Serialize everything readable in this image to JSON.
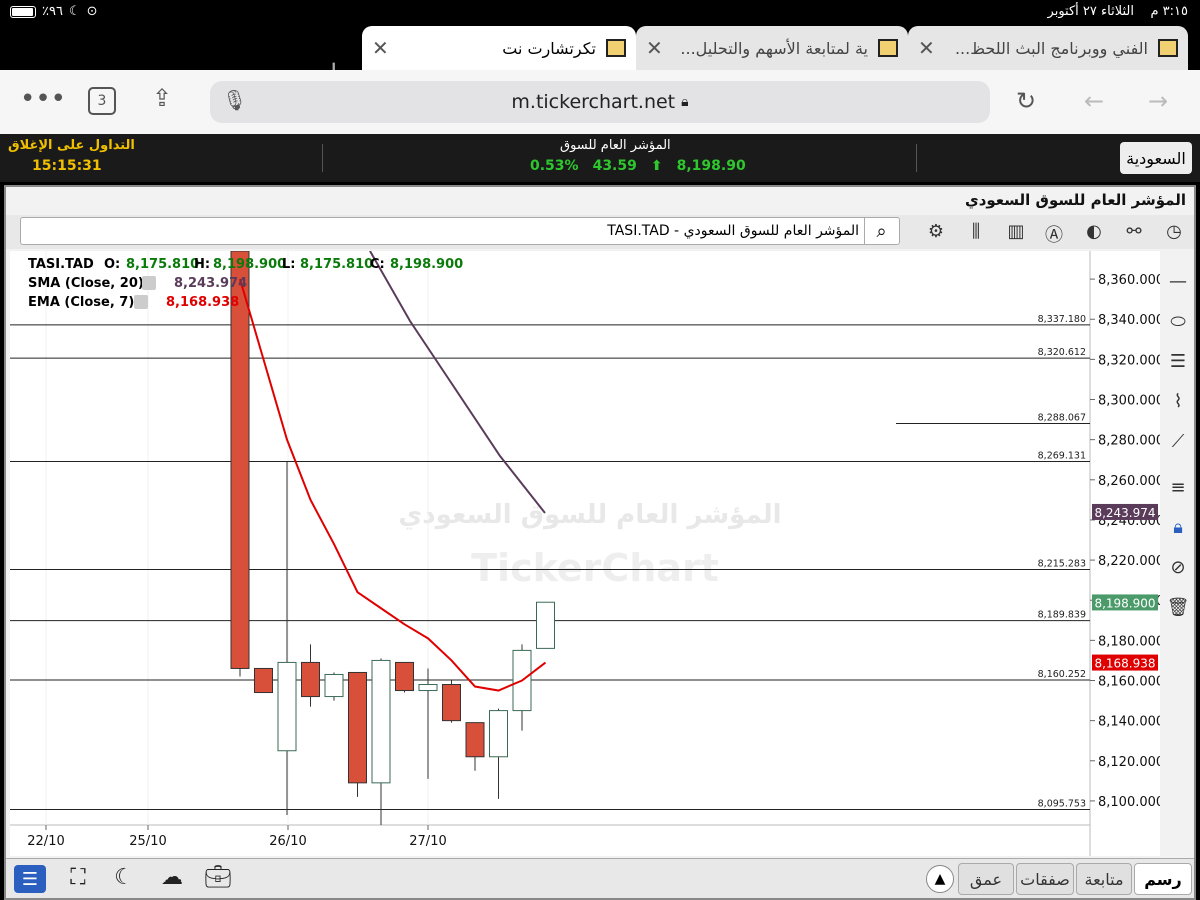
{
  "status": {
    "battery": "٪٩٦",
    "time": "٣:١٥ م",
    "date": "الثلاثاء ٢٧ أكتوبر"
  },
  "tabs": [
    {
      "label": "تكرتشارت نت",
      "active": true
    },
    {
      "label": "ية لمتابعة الأسهم والتحليل...",
      "active": false
    },
    {
      "label": "الفني ووبرنامج البث اللحظ...",
      "active": false
    }
  ],
  "browser": {
    "url": "m.tickerchart.net",
    "tab_count": "3"
  },
  "header": {
    "status_label": "التداول على الإغلاق",
    "clock": "15:15:31",
    "index_title": "المؤشر العام للسوق",
    "change_pct": "0.53%",
    "change": "43.59",
    "last": "8,198.90",
    "market": "السعودية"
  },
  "panel": {
    "title": "المؤشر العام للسوق السعودي",
    "symbol": "TASI.TAD - المؤشر العام للسوق السعودي"
  },
  "legend": {
    "ticker": "TASI.TAD",
    "o_label": "O:",
    "o": "8,175.810",
    "h_label": "H:",
    "h": "8,198.900",
    "l_label": "L:",
    "l": "8,175.810",
    "c_label": "C:",
    "c": "8,198.900",
    "sma_label": "SMA  (Close, 20)",
    "sma": "8,243.974",
    "ema_label": "EMA  (Close, 7)",
    "ema": "8,168.938"
  },
  "watermark": {
    "name": "المؤشر العام للسوق السعودي",
    "brand": "TickerChart"
  },
  "colors": {
    "up": "#ffffff",
    "down": "#d9503a",
    "sma": "#5a3c5a",
    "ema": "#e00000",
    "up_text": "#2ec82e",
    "clock": "#f0c000"
  },
  "chart_data": {
    "type": "candlestick",
    "y_ticks": [
      "8,100.000",
      "8,120.000",
      "8,140.000",
      "8,160.000",
      "8,180.000",
      "8,200.000",
      "8,220.000",
      "8,240.000",
      "8,260.000",
      "8,280.000",
      "8,300.000",
      "8,320.000",
      "8,340.000",
      "8,360.000"
    ],
    "ylim": [
      8088,
      8374
    ],
    "x_labels": [
      "22/10",
      "25/10",
      "26/10",
      "27/10"
    ],
    "levels": [
      8337.18,
      8320.612,
      8288.067,
      8269.131,
      8215.283,
      8189.839,
      8160.252,
      8095.753
    ],
    "level_labels": [
      "8,337.180",
      "8,320.612",
      "8,288.067",
      "8,269.131",
      "8,215.283",
      "8,189.839",
      "8,160.252",
      "8,095.753"
    ],
    "candles": [
      {
        "o": 8374,
        "h": 8374,
        "l": 8162,
        "c": 8166
      },
      {
        "o": 8166,
        "h": 8166,
        "l": 8154,
        "c": 8154
      },
      {
        "o": 8125,
        "h": 8269,
        "l": 8093,
        "c": 8169
      },
      {
        "o": 8169,
        "h": 8178,
        "l": 8147,
        "c": 8152
      },
      {
        "o": 8152,
        "h": 8164,
        "l": 8150,
        "c": 8163
      },
      {
        "o": 8164,
        "h": 8164,
        "l": 8102,
        "c": 8109
      },
      {
        "o": 8109,
        "h": 8171,
        "l": 8088,
        "c": 8170
      },
      {
        "o": 8169,
        "h": 8169,
        "l": 8154,
        "c": 8155
      },
      {
        "o": 8155,
        "h": 8166,
        "l": 8111,
        "c": 8158
      },
      {
        "o": 8158,
        "h": 8160,
        "l": 8139,
        "c": 8140
      },
      {
        "o": 8139,
        "h": 8139,
        "l": 8115,
        "c": 8122
      },
      {
        "o": 8122,
        "h": 8146,
        "l": 8101,
        "c": 8145
      },
      {
        "o": 8145,
        "h": 8178,
        "l": 8135,
        "c": 8175
      },
      {
        "o": 8176,
        "h": 8199,
        "l": 8176,
        "c": 8199
      }
    ],
    "sma_series": [
      null,
      null,
      null,
      null,
      null,
      null,
      null,
      null,
      null,
      null,
      null,
      null,
      null,
      8243.974
    ],
    "sma_points": [
      [
        0,
        8374
      ],
      [
        13,
        8243.974
      ]
    ],
    "ema_series": [
      8360,
      8320,
      8280,
      8250,
      8228,
      8204,
      8196,
      8188,
      8181,
      8170,
      8157,
      8155,
      8160,
      8168.938
    ],
    "last_price_tag": "8,198.900",
    "sma_tag": "8,243.974",
    "ema_tag": "8,168.938"
  }
}
